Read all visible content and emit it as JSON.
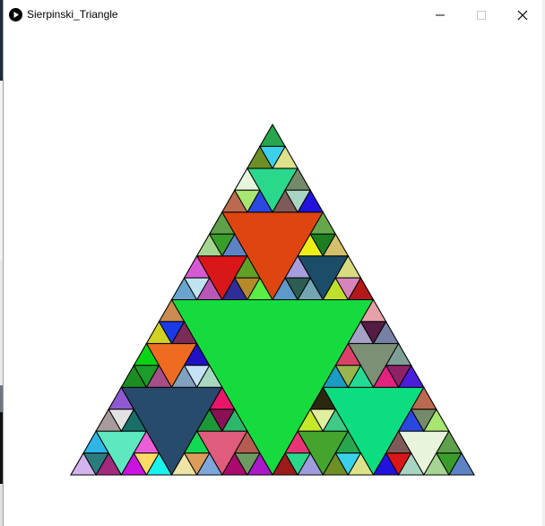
{
  "window": {
    "title": "Sierpinski_Triangle",
    "icon": "play-icon",
    "controls": [
      "minimize-icon",
      "maximize-icon",
      "close-icon"
    ]
  },
  "sketch": {
    "type": "sierpinski-triangle",
    "recursion_depth": 4,
    "stroke_color": "#000000",
    "background": "#ffffff",
    "center_color": "#16db3e",
    "level_1_colors": [
      "#df4510",
      "#284a6c",
      "#0bdd80"
    ],
    "palette": [
      "#9f9bdc",
      "#2ad88b",
      "#27a74d",
      "#6e8f26",
      "#dde28a",
      "#3bd1ea",
      "#e8f5dc",
      "#bb6a4f",
      "#2a48e0",
      "#a6e671",
      "#748a6a",
      "#7e5a58",
      "#2113dd",
      "#a8d5c1",
      "#d91618",
      "#5fa04d",
      "#a6d492",
      "#5c84c4",
      "#3a9d29",
      "#d85ad3",
      "#6aa3cd",
      "#b957b8",
      "#bfe3f1",
      "#61a028",
      "#2f2d99",
      "#58ee43",
      "#b68a2b",
      "#1b4d69",
      "#67a74b",
      "#ecee18",
      "#d4bf6a",
      "#1c7e20",
      "#a79ede",
      "#5d9acb",
      "#72a6b4",
      "#2c5d52",
      "#d8db80",
      "#bfdf2d",
      "#b11a19",
      "#d783be",
      "#ee6c22",
      "#c98b4f",
      "#d2d223",
      "#7b2b56",
      "#1a3ae8",
      "#0ad314",
      "#1b8d23",
      "#a64e87",
      "#1c9c29",
      "#2011c4",
      "#81a1c0",
      "#a8d8c0",
      "#c4e1f5",
      "#5de8c0",
      "#8e59d0",
      "#a89b9c",
      "#176f68",
      "#e2e2e2",
      "#2fb5e6",
      "#d3b3eb",
      "#a12a7e",
      "#2b7b7e",
      "#eb5ed9",
      "#c913de",
      "#1af3ed",
      "#ffd966",
      "#e05c7c",
      "#e81568",
      "#1b9939",
      "#2bb86a",
      "#8a1155",
      "#12d952",
      "#ede4a5",
      "#7ea7db",
      "#db9d59",
      "#b65d52",
      "#a80a6e",
      "#a919c7",
      "#6c9a62",
      "#7c9076",
      "#e5a1a8",
      "#a5a1c9",
      "#7681a5",
      "#541c42",
      "#d9426a",
      "#1a9cc4",
      "#23db95",
      "#99b54d",
      "#7e9e98",
      "#e3227f",
      "#4a1ddb",
      "#8f2267",
      "#44a52e",
      "#2c2710",
      "#c6e72a",
      "#3ecb89",
      "#dfee9f",
      "#e63574",
      "#9b1a1a"
    ]
  }
}
